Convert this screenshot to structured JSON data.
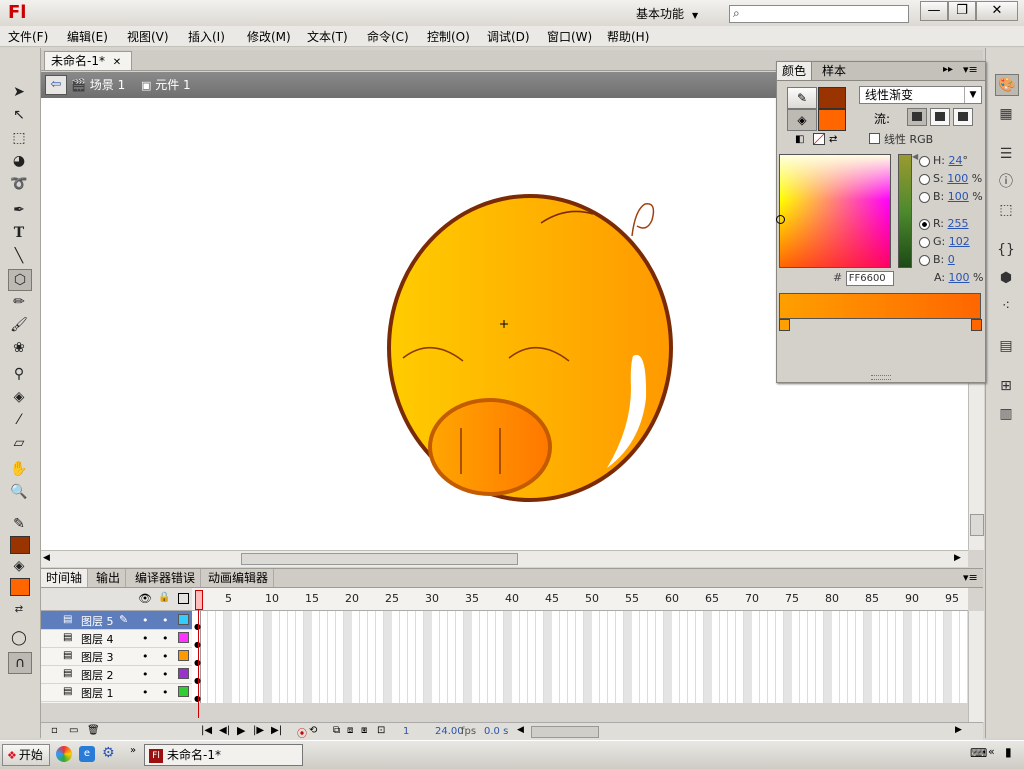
{
  "app": {
    "logo": "Fl",
    "workspace": "基本功能",
    "search_placeholder": ""
  },
  "window_buttons": {
    "minimize": "—",
    "restore": "❐",
    "close": "✕"
  },
  "menu": [
    "文件(F)",
    "编辑(E)",
    "视图(V)",
    "插入(I)",
    "修改(M)",
    "文本(T)",
    "命令(C)",
    "控制(O)",
    "调试(D)",
    "窗口(W)",
    "帮助(H)"
  ],
  "document": {
    "tab": "未命名-1*",
    "tab_close": "✕",
    "breadcrumb": [
      "场景 1",
      "元件 1"
    ]
  },
  "color_panel": {
    "tabs": [
      "颜色",
      "样本"
    ],
    "type": "线性渐变",
    "flow_label": "流:",
    "linear_rgb_label": "线性 RGB",
    "stroke_color": "#993300",
    "fill_color": "#FF6600",
    "hsb": {
      "H": "24",
      "S": "100",
      "B": "100",
      "h_unit": "°",
      "pct": "%"
    },
    "rgb": {
      "R": "255",
      "G": "102",
      "B": "0"
    },
    "alpha": "100",
    "alpha_unit": "%",
    "hex_label": "#",
    "hex": "FF6600",
    "labels": {
      "H": "H:",
      "S": "S:",
      "B": "B:",
      "R": "R:",
      "G": "G:",
      "B2": "B:",
      "A": "A:"
    }
  },
  "timeline": {
    "tabs": [
      "时间轴",
      "输出",
      "编译器错误",
      "动画编辑器"
    ],
    "frame_numbers": [
      "1",
      "5",
      "10",
      "15",
      "20",
      "25",
      "30",
      "35",
      "40",
      "45",
      "50",
      "55",
      "60",
      "65",
      "70",
      "75",
      "80",
      "85",
      "90",
      "95"
    ],
    "layers": [
      {
        "name": "图层 5",
        "color": "#33ccff",
        "selected": true
      },
      {
        "name": "图层 4",
        "color": "#ff33ff",
        "selected": false
      },
      {
        "name": "图层 3",
        "color": "#ff9900",
        "selected": false
      },
      {
        "name": "图层 2",
        "color": "#9933cc",
        "selected": false
      },
      {
        "name": "图层 1",
        "color": "#33cc33",
        "selected": false
      }
    ],
    "status": {
      "frame": "1",
      "fps": "24.00",
      "fps_unit": "fps",
      "time": "0.0 s"
    }
  },
  "toolbar": {
    "stroke_color": "#993300",
    "fill_color": "#FF6600"
  },
  "taskbar": {
    "start": "开始",
    "item": "未命名-1*"
  }
}
